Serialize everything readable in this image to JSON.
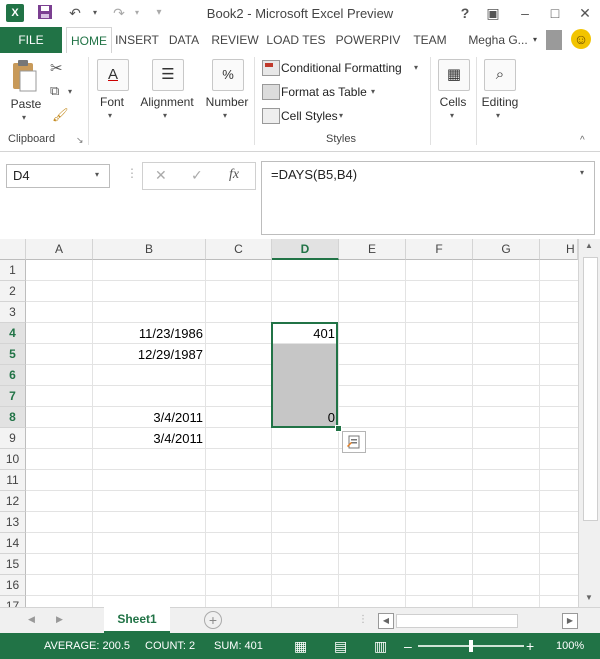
{
  "window": {
    "title": "Book2 - Microsoft Excel Preview"
  },
  "tabs": [
    "FILE",
    "HOME",
    "INSERT",
    "DATA",
    "REVIEW",
    "LOAD TES",
    "POWERPIV",
    "TEAM"
  ],
  "user": {
    "name": "Megha G..."
  },
  "ribbon": {
    "clipboard": {
      "paste": "Paste",
      "label": "Clipboard"
    },
    "font": "Font",
    "alignment": "Alignment",
    "number": "Number",
    "styles": {
      "conditional": "Conditional Formatting",
      "format_table": "Format as Table",
      "cell_styles": "Cell Styles",
      "label": "Styles"
    },
    "cells": "Cells",
    "editing": "Editing"
  },
  "formula_bar": {
    "name_box": "D4",
    "fx": "fx",
    "formula": "=DAYS(B5,B4)"
  },
  "grid": {
    "columns": [
      "A",
      "B",
      "C",
      "D",
      "E",
      "F",
      "G",
      "H"
    ],
    "rows": [
      "1",
      "2",
      "3",
      "4",
      "5",
      "6",
      "7",
      "8",
      "9",
      "10",
      "11",
      "12",
      "13",
      "14",
      "15",
      "16",
      "17"
    ],
    "cells": {
      "B4": "11/23/1986",
      "B5": "12/29/1987",
      "B8": "3/4/2011",
      "B9": "3/4/2011",
      "D4": "401",
      "D8": "0"
    }
  },
  "sheet_tabs": {
    "active": "Sheet1"
  },
  "status": {
    "average": "AVERAGE: 200.5",
    "count": "COUNT: 2",
    "sum": "SUM: 401",
    "zoom": "100%"
  },
  "colors": {
    "accent": "#217346"
  }
}
